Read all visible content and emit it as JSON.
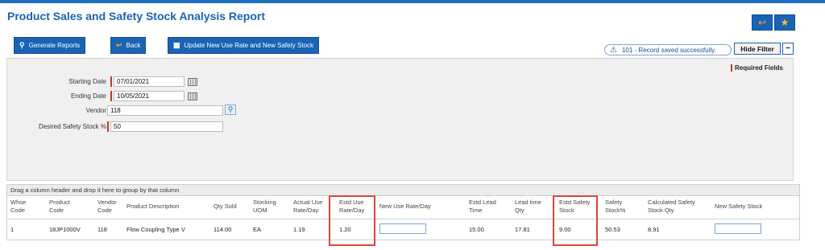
{
  "title": "Product Sales and Safety Stock Analysis Report",
  "top_buttons": {
    "back_icon": "back-arrow-icon",
    "fav_icon": "star-icon"
  },
  "toolbar": {
    "generate": "Generate Reports",
    "back": "Back",
    "update": "Update New Use Rate and New Safety Stock"
  },
  "notice": "101 - Record saved successfully.",
  "hide_filter": "Hide Filter",
  "minus": "−",
  "required_fields": "Required Fields",
  "filters": {
    "starting_date_label": "Starting Date",
    "starting_date": "07/01/2021",
    "ending_date_label": "Ending Date",
    "ending_date": "10/05/2021",
    "vendor_label": "Vendor",
    "vendor": "118",
    "safety_label": "Desired Safety Stock %",
    "safety": "50"
  },
  "grid": {
    "group_hint": "Drag a column header and drop it here to group by that column",
    "headers": {
      "whse": "Whse\nCode",
      "product": "Product\nCode",
      "vendor": "Vendor\nCode",
      "desc": "Product Description",
      "qty": "Qty Sold",
      "uom": "Stocking\nUOM",
      "actual": "Actual Use\nRate/Day",
      "estd": "Estd Use\nRate/Day",
      "newuse": "New Use Rate/Day",
      "lead": "Estd Lead\nTime",
      "leadqty": "Lead time\nQty",
      "estdsafety": "Estd Safety\nStock",
      "safetypct": "Safety\nStock%",
      "calc": "Calculated Safety\nStock Qty",
      "newsafety": "New Safety Stock"
    },
    "row": {
      "whse": "1",
      "product": "18JP1000V",
      "vendor": "118",
      "desc": "Flow Coupling Type V",
      "qty": "114.00",
      "uom": "EA",
      "actual": "1.19",
      "estd": "1.20",
      "lead": "15.00",
      "leadqty": "17.81",
      "estdsafety": "9.00",
      "safetypct": "50.53",
      "calc": "8.91"
    }
  }
}
